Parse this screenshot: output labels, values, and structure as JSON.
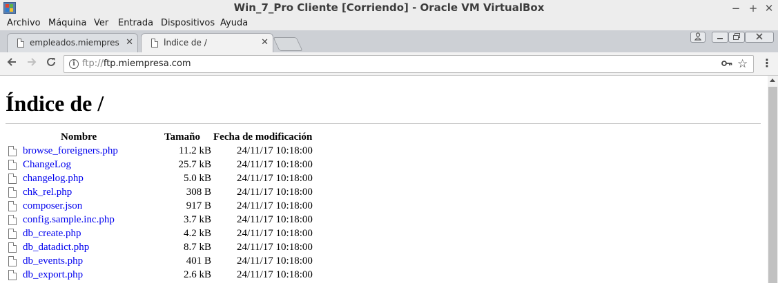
{
  "window": {
    "title": "Win_7_Pro Cliente [Corriendo] - Oracle VM VirtualBox",
    "controls": {
      "minimize": "−",
      "maximize": "+",
      "close": "✕"
    }
  },
  "menubar": {
    "items": [
      "Archivo",
      "Máquina",
      "Ver",
      "Entrada",
      "Dispositivos",
      "Ayuda"
    ]
  },
  "browser": {
    "tabs": [
      {
        "label": "empleados.miempresa.com",
        "active": false,
        "close": "✕"
      },
      {
        "label": "Índice de /",
        "active": true,
        "close": "✕"
      }
    ],
    "url_scheme": "ftp://",
    "url_host": "ftp.miempresa.com",
    "icons": {
      "back": "arrow-left",
      "forward": "arrow-right",
      "reload": "reload",
      "info": "info-circle",
      "key": "key",
      "star": "star",
      "menu": "vertical-dots"
    }
  },
  "page": {
    "title": "Índice de /",
    "headers": {
      "name": "Nombre",
      "size": "Tamaño",
      "date": "Fecha de modificación"
    },
    "files": [
      {
        "name": "browse_foreigners.php",
        "size": "11.2 kB",
        "date": "24/11/17 10:18:00"
      },
      {
        "name": "ChangeLog",
        "size": "25.7 kB",
        "date": "24/11/17 10:18:00"
      },
      {
        "name": "changelog.php",
        "size": "5.0 kB",
        "date": "24/11/17 10:18:00"
      },
      {
        "name": "chk_rel.php",
        "size": "308 B",
        "date": "24/11/17 10:18:00"
      },
      {
        "name": "composer.json",
        "size": "917 B",
        "date": "24/11/17 10:18:00"
      },
      {
        "name": "config.sample.inc.php",
        "size": "3.7 kB",
        "date": "24/11/17 10:18:00"
      },
      {
        "name": "db_create.php",
        "size": "4.2 kB",
        "date": "24/11/17 10:18:00"
      },
      {
        "name": "db_datadict.php",
        "size": "8.7 kB",
        "date": "24/11/17 10:18:00"
      },
      {
        "name": "db_events.php",
        "size": "401 B",
        "date": "24/11/17 10:18:00"
      },
      {
        "name": "db_export.php",
        "size": "2.6 kB",
        "date": "24/11/17 10:18:00"
      }
    ]
  },
  "colors": {
    "link": "#0000ee",
    "chrome_frame": "#cdd0d5",
    "titlebar": "#ededed"
  }
}
